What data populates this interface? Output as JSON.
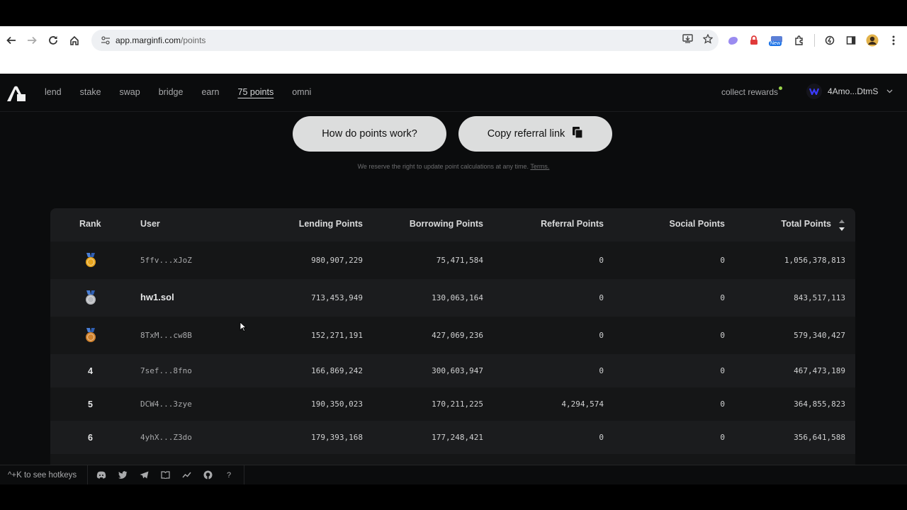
{
  "browser": {
    "url_host": "app.marginfi.com",
    "url_path": "/points",
    "new_badge": "New"
  },
  "nav": {
    "links": [
      "lend",
      "stake",
      "swap",
      "bridge",
      "earn",
      "75 points",
      "omni"
    ],
    "active_index": 5,
    "collect_rewards": "collect rewards",
    "wallet": "4Amo...DtmS"
  },
  "buttons": {
    "how_points": "How do points work?",
    "copy_referral": "Copy referral link"
  },
  "disclaimer": {
    "text": "We reserve the right to update point calculations at any time.",
    "terms": "Terms."
  },
  "table": {
    "headers": [
      "Rank",
      "User",
      "Lending Points",
      "Borrowing Points",
      "Referral Points",
      "Social Points",
      "Total Points"
    ],
    "rows": [
      {
        "rank": "1",
        "medal": "gold",
        "user": "5ffv...xJoZ",
        "named": false,
        "lending": "980,907,229",
        "borrowing": "75,471,584",
        "referral": "0",
        "social": "0",
        "total": "1,056,378,813"
      },
      {
        "rank": "2",
        "medal": "silver",
        "user": "hw1.sol",
        "named": true,
        "lending": "713,453,949",
        "borrowing": "130,063,164",
        "referral": "0",
        "social": "0",
        "total": "843,517,113"
      },
      {
        "rank": "3",
        "medal": "bronze",
        "user": "8TxM...cw8B",
        "named": false,
        "lending": "152,271,191",
        "borrowing": "427,069,236",
        "referral": "0",
        "social": "0",
        "total": "579,340,427"
      },
      {
        "rank": "4",
        "medal": "",
        "user": "7sef...8fno",
        "named": false,
        "lending": "166,869,242",
        "borrowing": "300,603,947",
        "referral": "0",
        "social": "0",
        "total": "467,473,189"
      },
      {
        "rank": "5",
        "medal": "",
        "user": "DCW4...3zye",
        "named": false,
        "lending": "190,350,023",
        "borrowing": "170,211,225",
        "referral": "4,294,574",
        "social": "0",
        "total": "364,855,823"
      },
      {
        "rank": "6",
        "medal": "",
        "user": "4yhX...Z3do",
        "named": false,
        "lending": "179,393,168",
        "borrowing": "177,248,421",
        "referral": "0",
        "social": "0",
        "total": "356,641,588"
      }
    ]
  },
  "footer": {
    "hotkeys": "^+K to see hotkeys",
    "icons": [
      "discord-icon",
      "twitter-icon",
      "telegram-icon",
      "docs-icon",
      "analytics-icon",
      "github-icon",
      "help-icon"
    ],
    "help": "?"
  }
}
